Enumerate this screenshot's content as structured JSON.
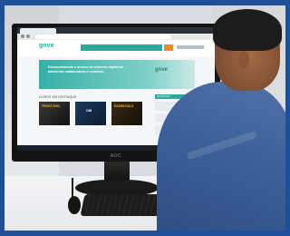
{
  "photo": {
    "subject": "",
    "border_color": "#1f4f98"
  },
  "monitor": {
    "brand": "AOC"
  },
  "website": {
    "logo_text": "gnve",
    "hero": {
      "title": "Democratizando o acesso ao universo digital em ambientes colaborativos e criativos."
    },
    "books_section_label": "LIVROS EM DESTAQUE",
    "books": [
      {
        "title": "FRONT-END"
      },
      {
        "title": "CIM"
      },
      {
        "title": "ESSENTIALS"
      }
    ],
    "sidebar_label": "NOTÍCIAS",
    "colors": {
      "accent": "#2fa89a",
      "orange": "#f08a24"
    }
  }
}
